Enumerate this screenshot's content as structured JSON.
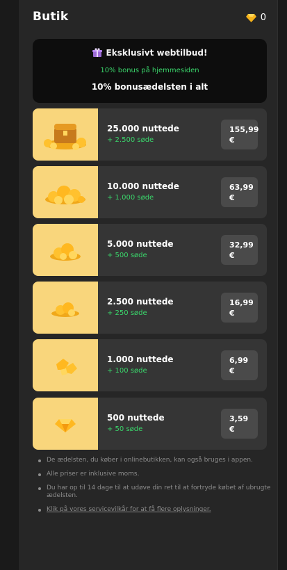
{
  "header": {
    "title": "Butik",
    "balance": "0"
  },
  "banner": {
    "title": "Eksklusivt webtilbud!",
    "bonus_line": "10% bonus på hjemmesiden",
    "gems_line": "10% bonusædelsten i alt"
  },
  "offers": [
    {
      "name": "25.000 nuttede",
      "bonus": "+ 2.500 søde",
      "price": "155,99\n€",
      "icon": "treasure-chest-icon"
    },
    {
      "name": "10.000 nuttede",
      "bonus": "+ 1.000 søde",
      "price": "63,99\n€",
      "icon": "gem-pile-large-icon"
    },
    {
      "name": "5.000 nuttede",
      "bonus": "+ 500 søde",
      "price": "32,99\n€",
      "icon": "gem-pile-medium-icon"
    },
    {
      "name": "2.500 nuttede",
      "bonus": "+ 250 søde",
      "price": "16,99\n€",
      "icon": "gem-pile-small-icon"
    },
    {
      "name": "1.000 nuttede",
      "bonus": "+ 100 søde",
      "price": "6,99\n€",
      "icon": "gem-cluster-icon"
    },
    {
      "name": "500 nuttede",
      "bonus": "+ 50 søde",
      "price": "3,59\n€",
      "icon": "single-gem-icon"
    }
  ],
  "notes": {
    "n1": "De ædelsten, du køber i onlinebutikken, kan også bruges i appen.",
    "n2": "Alle priser er inklusive moms.",
    "n3": "Du har op til 14 dage til at udøve din ret til at fortryde købet af ubrugte ædelsten.",
    "n4": "Klik på vores servicevilkår for at få flere oplysninger."
  },
  "colors": {
    "accent_green": "#3ad66b",
    "thumb_yellow": "#f9d67c",
    "gem_gold": "#f6b21a"
  }
}
